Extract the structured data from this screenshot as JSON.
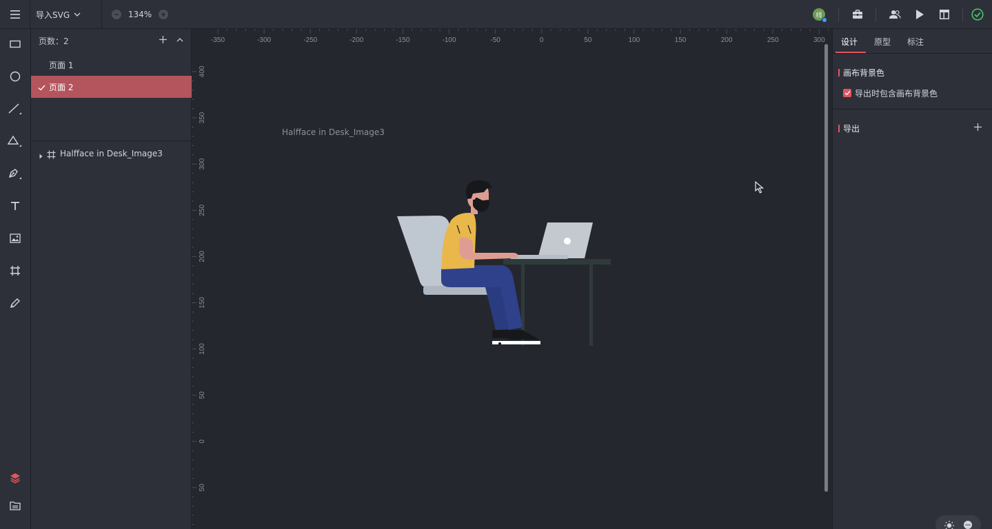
{
  "toolbar": {
    "import_label": "导入SVG",
    "zoom_value": "134%",
    "avatar_text": "线"
  },
  "pages": {
    "count_label": "页数：2",
    "items": [
      {
        "label": "页面 1",
        "active": false
      },
      {
        "label": "页面 2",
        "active": true
      }
    ]
  },
  "layers": {
    "items": [
      {
        "label": "Halfface in Desk_Image3"
      }
    ]
  },
  "canvas": {
    "frame_label": "Halfface in Desk_Image3",
    "h_ruler_ticks": [
      "-350",
      "-300",
      "-250",
      "-200",
      "-150",
      "-100",
      "-50",
      "0",
      "50",
      "100",
      "150",
      "200",
      "250",
      "300"
    ],
    "v_ruler_ticks": [
      "400",
      "350",
      "300",
      "250",
      "200",
      "150",
      "100",
      "50",
      "0",
      "50"
    ]
  },
  "right_panel": {
    "tabs": [
      "设计",
      "原型",
      "标注"
    ],
    "active_tab": 0,
    "canvas_bg_title": "画布背景色",
    "include_bg_label": "导出时包含画布背景色",
    "include_bg_checked": true,
    "export_title": "导出"
  },
  "colors": {
    "accent": "#e0575f",
    "active_page_bg": "#b4545c",
    "status_ok": "#4cc46a"
  },
  "icons": [
    "menu-icon",
    "chevron-down-icon",
    "zoom-out-icon",
    "zoom-in-icon",
    "briefcase-icon",
    "users-icon",
    "play-icon",
    "layout-icon",
    "check-circle-icon",
    "rectangle-icon",
    "ellipse-icon",
    "line-icon",
    "triangle-icon",
    "pen-icon",
    "text-icon",
    "image-icon",
    "artboard-icon",
    "pencil-icon",
    "layers-icon",
    "assets-icon",
    "plus-icon",
    "chevron-up-icon",
    "check-icon",
    "caret-right-icon",
    "frame-icon",
    "cursor-icon",
    "sun-icon",
    "chat-icon"
  ]
}
